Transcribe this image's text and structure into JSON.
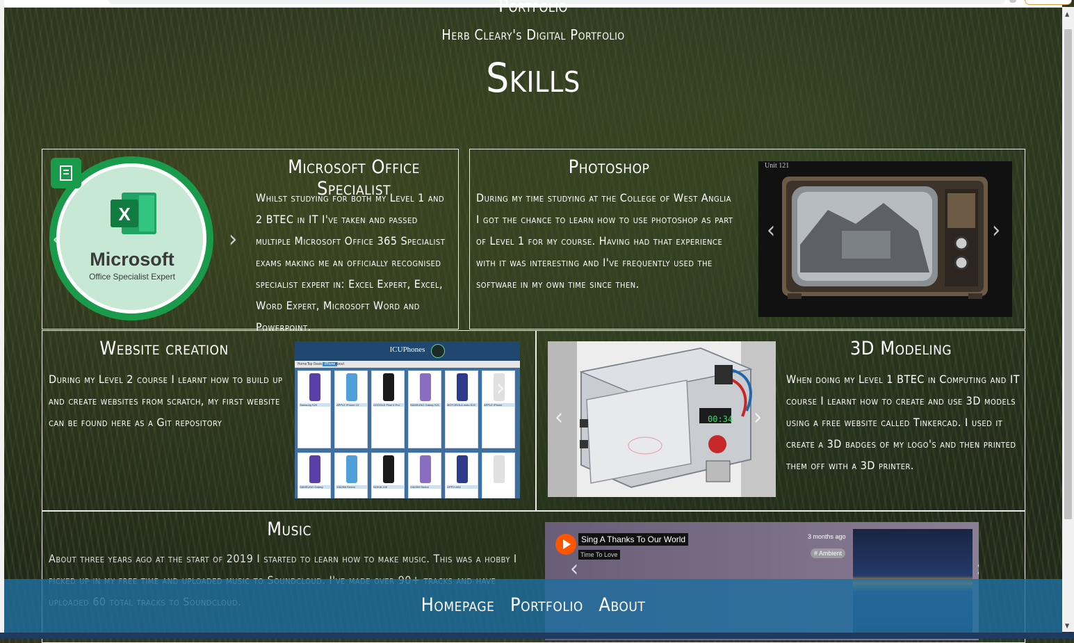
{
  "header": {
    "site_title": "Portfolio",
    "site_subtitle": "Herb Cleary's Digital Portfolio",
    "page_title": "Skills"
  },
  "cards": {
    "office": {
      "title": "Microsoft Office Specialist",
      "body": "Whilst studying for both my Level 1 and 2 BTEC in IT I've taken and passed multiple Microsoft Office 365 Specialist exams making me an officially recognised specialist expert in: Excel Expert, Excel, Word Expert, Microsoft Word and Powerpoint.",
      "badge_brand": "Microsoft",
      "badge_sub": "Office Specialist Expert"
    },
    "photoshop": {
      "title": "Photoshop",
      "body": "During my time studying at the College of West Anglia I got the chance to learn how to use photoshop as part of Level 1 for my course. Having had that experience with it was interesting and I've frequently used the software in my own time since then.",
      "image_caption": "Unit 121"
    },
    "website": {
      "title": "Website creation",
      "body": "During my Level 2 course I learnt how to build up and create websites from scratch, my first website can be found here as a Git repository",
      "site_name": "ICUPhones",
      "site_tabs": [
        "Home",
        "Top Deals",
        "iPhone",
        "About"
      ],
      "phones_row1": [
        "Samsung S20",
        "APPLE iPhone 13",
        "GOOGLE Pixel 6 Pro",
        "SAMSUNG Galaxy S21",
        "MOTOROLA moto E20",
        "APPLE iPhone"
      ],
      "phones_row2": [
        "SAMSUNG Galaxy",
        "XIAOMI Redmi",
        "NOKIA 105",
        "XIAOMI Redmi",
        "OPPO A54",
        ""
      ]
    },
    "modeling": {
      "title": "3D Modeling",
      "body": "When doing my Level 1 BTEC in Computing and IT course I learnt how to create and use 3D models using a free website called Tinkercad. I used it create a 3D badges of my logo's and then printed them off with a 3D printer.",
      "timer": "00:34"
    },
    "music": {
      "title": "Music",
      "body": "About three years ago at the start of 2019 I started to learn how to make music. This was a hobby I picked up in my free time and uploaded music to Soundcloud. I've made over 90+ tracks and have uploaded 60 total tracks to Soundcloud.",
      "track_title": "Sing A Thanks To Our World",
      "artist": "Time To Love",
      "posted": "3 months ago",
      "tag": "# Ambient"
    }
  },
  "nav": {
    "links": [
      "Homepage",
      "Portfolio",
      "About"
    ]
  },
  "colors": {
    "footer": "#1e6ea0",
    "excel_green": "#107c41",
    "soundcloud_orange": "#ff5500"
  }
}
